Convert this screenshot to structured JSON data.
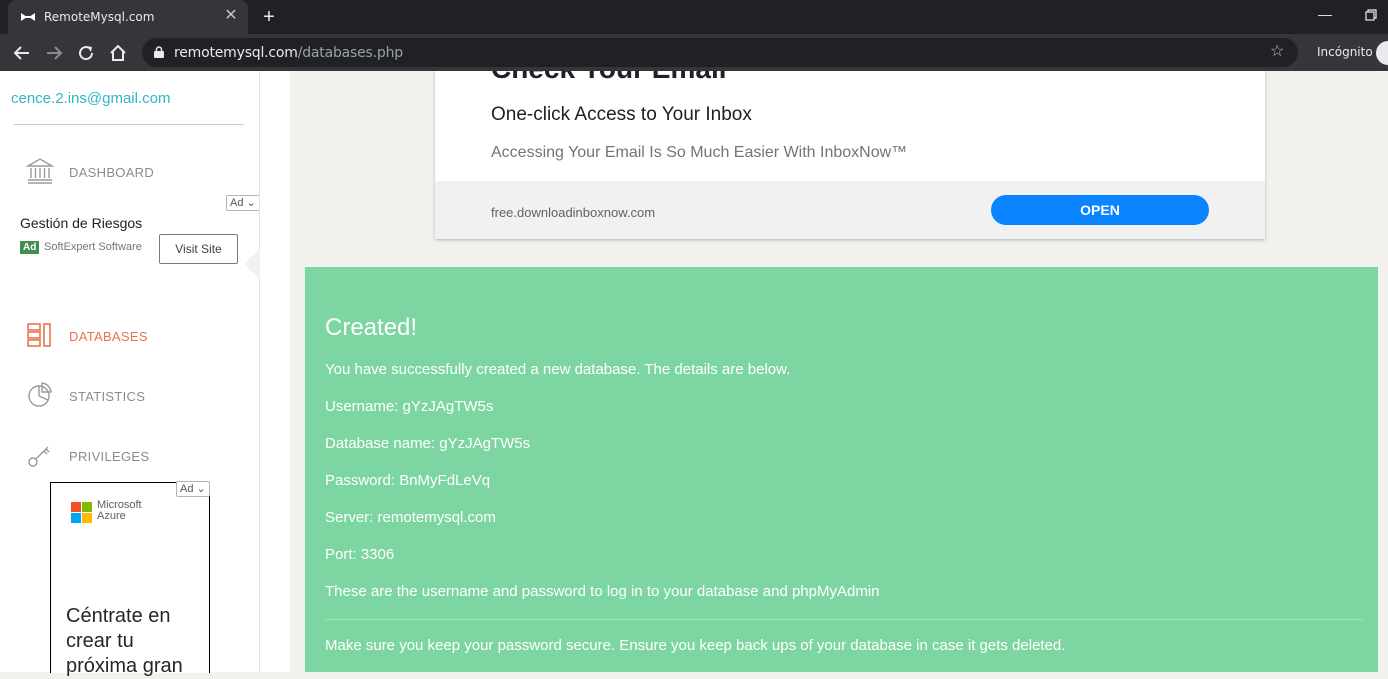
{
  "browser": {
    "tab_title": "RemoteMysql.com",
    "url_host": "remotemysql.com",
    "url_path": "/databases.php",
    "profile_label": "Incógnito"
  },
  "sidebar": {
    "user_email": "cence.2.ins@gmail.com",
    "items": [
      {
        "label": "DASHBOARD",
        "icon": "bank-icon",
        "active": false
      },
      {
        "label": "DATABASES",
        "icon": "database-list-icon",
        "active": true
      },
      {
        "label": "STATISTICS",
        "icon": "pie-chart-icon",
        "active": false
      },
      {
        "label": "PRIVILEGES",
        "icon": "key-icon",
        "active": false
      }
    ],
    "ad_top": {
      "badge": "Ad",
      "title": "Gestión de Riesgos",
      "tag": "Ad",
      "advertiser": "SoftExpert Software",
      "cta": "Visit Site"
    },
    "ad_bottom": {
      "badge": "Ad",
      "brand_line1": "Microsoft",
      "brand_line2": "Azure",
      "headline": "Céntrate en crear tu próxima gran"
    }
  },
  "main_ad": {
    "cut_title": "Check Your Email",
    "title": "One-click Access to Your Inbox",
    "description": "Accessing Your Email Is So Much Easier With InboxNow™",
    "display_url": "free.downloadinboxnow.com",
    "cta": "OPEN"
  },
  "result": {
    "heading": "Created!",
    "intro": "You have successfully created a new database. The details are below.",
    "username": "Username: gYzJAgTW5s",
    "database_name": "Database name: gYzJAgTW5s",
    "password": "Password: BnMyFdLeVq",
    "server": "Server: remotemysql.com",
    "port": "Port: 3306",
    "login_note": "These are the username and password to log in to your database and phpMyAdmin",
    "security_note": "Make sure you keep your password secure. Ensure you keep back ups of your database in case it gets deleted."
  },
  "colors": {
    "accent": "#2fb7c4",
    "active_nav": "#e8744e",
    "success_bg": "#7dd5a2",
    "open_button": "#0a84ff"
  }
}
